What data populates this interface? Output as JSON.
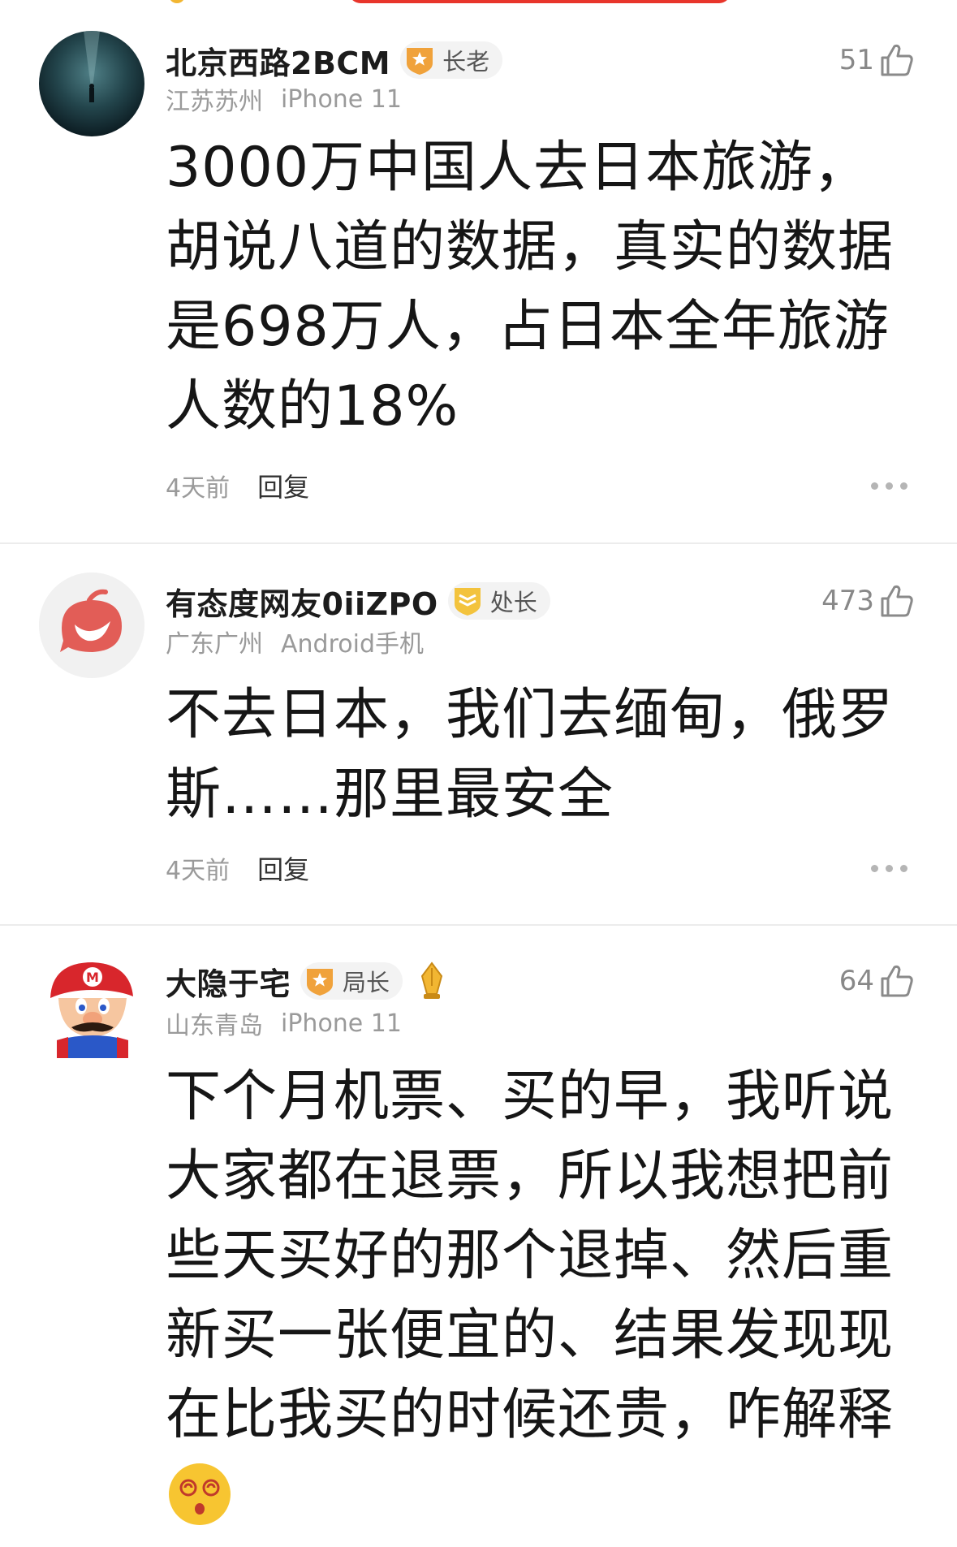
{
  "comments": [
    {
      "username": "北京西路2BCM",
      "rank": "长老",
      "location": "江苏苏州",
      "device": "iPhone 11",
      "likes": "51",
      "text": "3000万中国人去日本旅游，胡说八道的数据，真实的数据是698万人，占日本全年旅游人数的18%",
      "time": "4天前",
      "reply_label": "回复",
      "avatar": "underwater-diver-avatar",
      "badge_icon": "star-shield-badge-icon"
    },
    {
      "username": "有态度网友0iiZPO",
      "rank": "处长",
      "location": "广东广州",
      "device": "Android手机",
      "likes": "473",
      "text": "不去日本，我们去缅甸，俄罗斯……那里最安全",
      "time": "4天前",
      "reply_label": "回复",
      "avatar": "red-chat-bubble-avatar",
      "badge_icon": "chevron-shield-badge-icon"
    },
    {
      "username": "大隐于宅",
      "rank": "局长",
      "location": "山东青岛",
      "device": "iPhone 11",
      "likes": "64",
      "text": "下个月机票、买的早，我听说大家都在退票，所以我想把前些天买好的那个退掉、然后重新买一张便宜的、结果发现现在比我买的时候还贵，咋解释",
      "avatar": "mario-avatar",
      "badge_icon": "star-shield-badge-icon",
      "extra_icon": "crown-pen-icon",
      "emoji": "dizzy-face-emoji"
    }
  ],
  "colors": {
    "badge_orange": "#f0a23b",
    "badge_yellow": "#f3c33d",
    "muted": "#9a9a9a",
    "accent_red": "#e8352b"
  }
}
